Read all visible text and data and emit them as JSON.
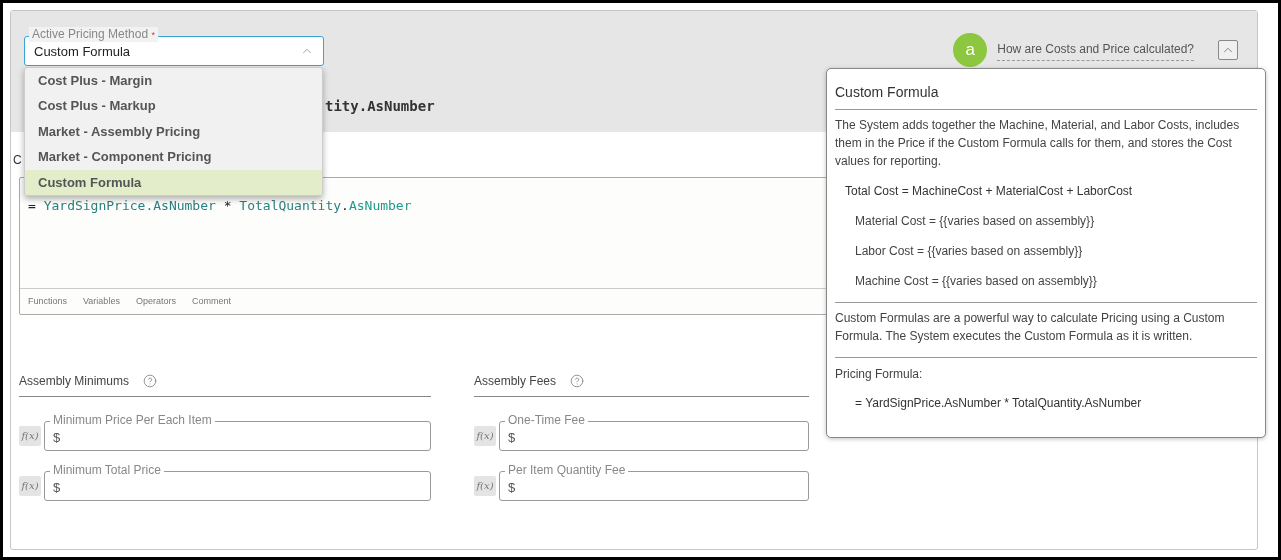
{
  "pricing_method": {
    "label": "Active Pricing Method",
    "required_mark": "*",
    "value": "Custom Formula",
    "expanded": true,
    "options": [
      {
        "label": "Cost Plus - Margin",
        "selected": false
      },
      {
        "label": "Cost Plus - Markup",
        "selected": false
      },
      {
        "label": "Market - Assembly Pricing",
        "selected": false
      },
      {
        "label": "Market - Component Pricing",
        "selected": false
      },
      {
        "label": "Custom Formula",
        "selected": true
      }
    ]
  },
  "help": {
    "badge": "a",
    "link": "How are Costs and Price calculated?",
    "expanded": true
  },
  "formula_preview_fragment": "tity.AsNumber",
  "formula_label_fragment": "C",
  "formula_editor": {
    "code": [
      {
        "kind": "operator",
        "text": "= "
      },
      {
        "kind": "identifier",
        "text": "YardSignPrice.AsNumber"
      },
      {
        "kind": "operator",
        "text": " * "
      },
      {
        "kind": "identifier",
        "text": "TotalQuantity"
      },
      {
        "kind": "operator",
        "text": "."
      },
      {
        "kind": "member",
        "text": "AsNumber"
      }
    ],
    "toolbar": [
      "Functions",
      "Variables",
      "Operators",
      "Comment"
    ]
  },
  "sections": [
    {
      "title": "Assembly Minimums",
      "fields": [
        {
          "label": "Minimum Price Per Each Item",
          "prefix": "$",
          "formula_button": "f(x)"
        },
        {
          "label": "Minimum Total Price",
          "prefix": "$",
          "formula_button": "f(x)"
        }
      ]
    },
    {
      "title": "Assembly Fees",
      "fields": [
        {
          "label": "One-Time Fee",
          "prefix": "$",
          "formula_button": "f(x)"
        },
        {
          "label": "Per Item Quantity Fee",
          "prefix": "$",
          "formula_button": "f(x)"
        }
      ]
    }
  ],
  "popover": {
    "title": "Custom Formula",
    "intro": "The System adds together the Machine, Material, and Labor Costs, includes them in the Price if the Custom Formula calls for them, and stores the Cost values for reporting.",
    "total_cost": "Total Cost = MachineCost + MaterialCost + LaborCost",
    "cost_lines": [
      "Material Cost = {{varies based on assembly}}",
      "Labor Cost = {{varies based on assembly}}",
      "Machine Cost = {{varies based on assembly}}"
    ],
    "description": "Custom Formulas are a powerful way to calculate Pricing using a Custom Formula. The System executes the Custom Formula as it is written.",
    "formula_label": "Pricing Formula:",
    "formula": "= YardSignPrice.AsNumber * TotalQuantity.AsNumber"
  }
}
